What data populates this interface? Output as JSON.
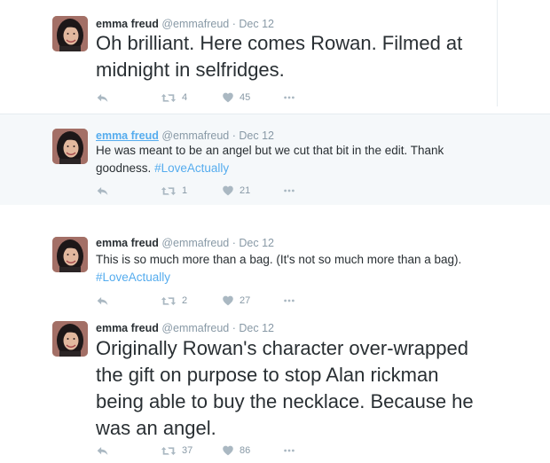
{
  "tweets": [
    {
      "author_name": "emma freud",
      "author_handle": "@emmafreud",
      "separator": "·",
      "date": "Dec 12",
      "text": "Oh brilliant. Here comes Rowan. Filmed at midnight in selfridges.",
      "hashtag": "",
      "retweets": "4",
      "likes": "45"
    },
    {
      "author_name": "emma freud",
      "author_handle": "@emmafreud",
      "separator": "·",
      "date": "Dec 12",
      "text": "He was meant to be an angel but we cut that bit in the edit. Thank goodness.",
      "hashtag": "#LoveActually",
      "retweets": "1",
      "likes": "21"
    },
    {
      "author_name": "emma freud",
      "author_handle": "@emmafreud",
      "separator": "·",
      "date": "Dec 12",
      "text": "This is so much more than a bag. (It's not so much more than a bag).",
      "hashtag": "#LoveActually",
      "retweets": "2",
      "likes": "27"
    },
    {
      "author_name": "emma freud",
      "author_handle": "@emmafreud",
      "separator": "·",
      "date": "Dec 12",
      "text": "Originally Rowan's character over-wrapped the gift on purpose to stop Alan rickman being able to buy the necklace. Because he was an angel.",
      "hashtag": "",
      "retweets": "37",
      "likes": "86"
    }
  ],
  "colors": {
    "link": "#55acee",
    "muted": "#8899a6",
    "highlight_bg": "#f5f8fa",
    "text": "#292f33"
  },
  "icons": {
    "reply": "reply-icon",
    "retweet": "retweet-icon",
    "like": "heart-icon",
    "more": "more-icon"
  }
}
